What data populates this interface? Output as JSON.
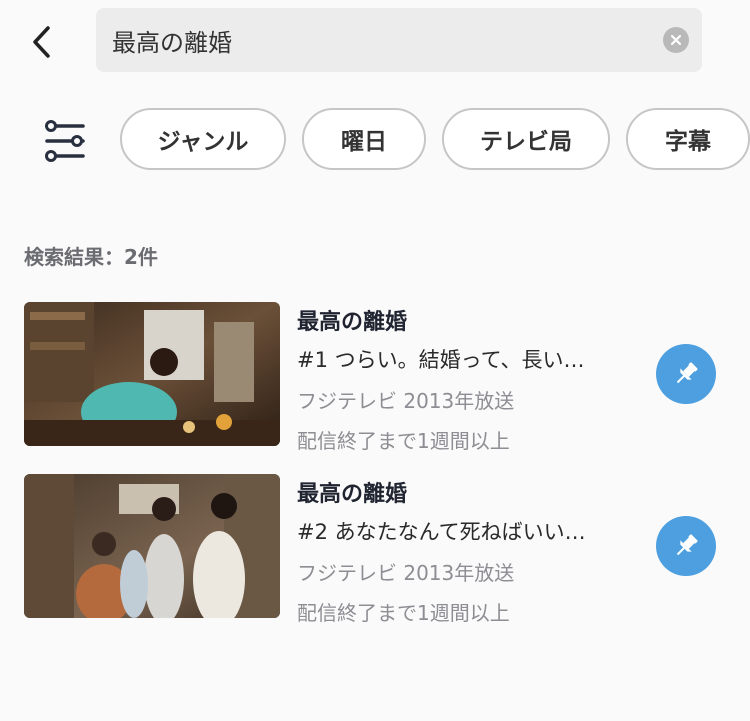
{
  "search": {
    "value": "最高の離婚"
  },
  "filters": {
    "chips": [
      "ジャンル",
      "曜日",
      "テレビ局",
      "字幕"
    ]
  },
  "results": {
    "count_label": "検索結果：2件",
    "items": [
      {
        "title": "最高の離婚",
        "episode": "#1 つらい。結婚って、長い…",
        "broadcaster": "フジテレビ 2013年放送",
        "availability": "配信終了まで1週間以上"
      },
      {
        "title": "最高の離婚",
        "episode": "#2 あなたなんて死ねばいい…",
        "broadcaster": "フジテレビ 2013年放送",
        "availability": "配信終了まで1週間以上"
      }
    ]
  },
  "colors": {
    "accent": "#4d9fe0",
    "background": "#fafafa"
  },
  "icons": [
    "back-chevron-icon",
    "clear-icon",
    "filter-sliders-icon",
    "pin-icon"
  ]
}
